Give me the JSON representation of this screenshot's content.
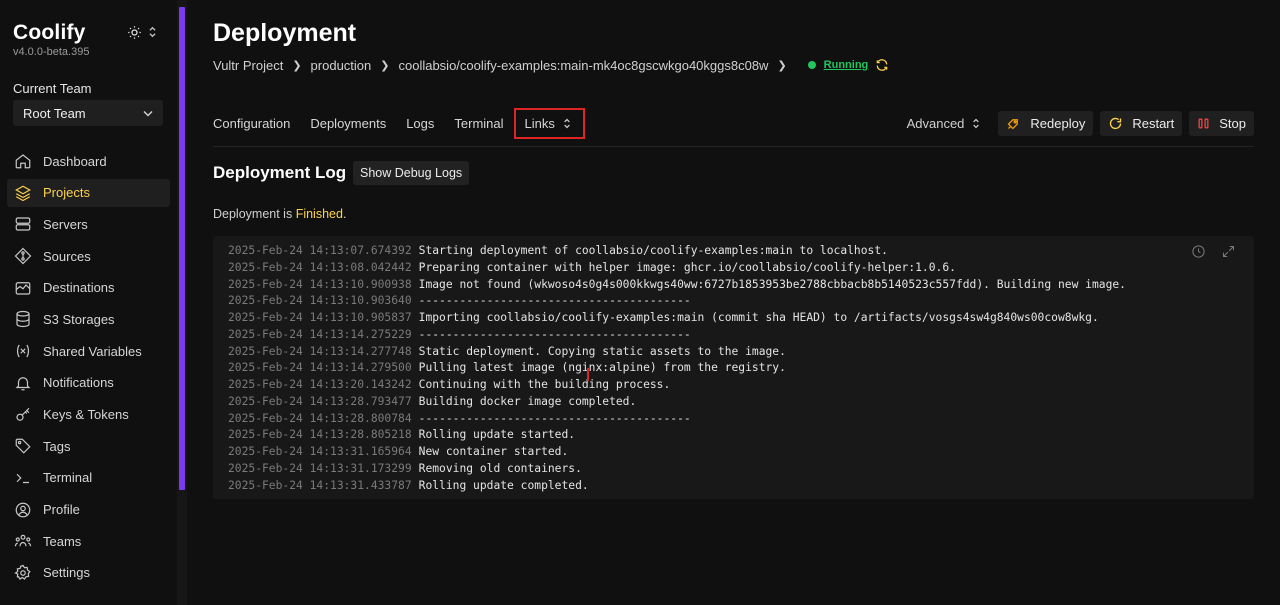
{
  "app": {
    "name": "Coolify",
    "version": "v4.0.0-beta.395"
  },
  "team": {
    "label": "Current Team",
    "selected": "Root Team"
  },
  "sidebar": {
    "items": [
      {
        "label": "Dashboard",
        "icon": "home-icon",
        "active": false
      },
      {
        "label": "Projects",
        "icon": "layers-icon",
        "active": true
      },
      {
        "label": "Servers",
        "icon": "server-icon",
        "active": false
      },
      {
        "label": "Sources",
        "icon": "git-icon",
        "active": false
      },
      {
        "label": "Destinations",
        "icon": "destination-icon",
        "active": false
      },
      {
        "label": "S3 Storages",
        "icon": "database-icon",
        "active": false
      },
      {
        "label": "Shared Variables",
        "icon": "variable-icon",
        "active": false
      },
      {
        "label": "Notifications",
        "icon": "bell-icon",
        "active": false
      },
      {
        "label": "Keys & Tokens",
        "icon": "key-icon",
        "active": false
      },
      {
        "label": "Tags",
        "icon": "tag-icon",
        "active": false
      },
      {
        "label": "Terminal",
        "icon": "terminal-icon",
        "active": false
      },
      {
        "label": "Profile",
        "icon": "user-icon",
        "active": false
      },
      {
        "label": "Teams",
        "icon": "users-icon",
        "active": false
      },
      {
        "label": "Settings",
        "icon": "gear-icon",
        "active": false
      }
    ]
  },
  "header": {
    "title": "Deployment",
    "breadcrumb": [
      "Vultr Project",
      "production",
      "coollabsio/coolify-examples:main-mk4oc8gscwkgo40kggs8c08w"
    ],
    "status": "Running"
  },
  "tabs": {
    "configuration": "Configuration",
    "deployments": "Deployments",
    "logs": "Logs",
    "terminal": "Terminal",
    "links": "Links"
  },
  "actions": {
    "advanced": "Advanced",
    "redeploy": "Redeploy",
    "restart": "Restart",
    "stop": "Stop"
  },
  "log": {
    "title": "Deployment Log",
    "debug_button": "Show Debug Logs",
    "status_prefix": "Deployment is ",
    "status_value": "Finished",
    "status_suffix": ".",
    "lines": [
      {
        "ts": "2025-Feb-24 14:13:07.674392",
        "msg": "Starting deployment of coollabsio/coolify-examples:main to localhost."
      },
      {
        "ts": "2025-Feb-24 14:13:08.042442",
        "msg": "Preparing container with helper image: ghcr.io/coollabsio/coolify-helper:1.0.6."
      },
      {
        "ts": "2025-Feb-24 14:13:10.900938",
        "msg": "Image not found (wkwoso4s0g4s000kkwgs40ww:6727b1853953be2788cbbacb8b5140523c557fdd). Building new image."
      },
      {
        "ts": "2025-Feb-24 14:13:10.903640",
        "msg": "----------------------------------------"
      },
      {
        "ts": "2025-Feb-24 14:13:10.905837",
        "msg": "Importing coollabsio/coolify-examples:main (commit sha HEAD) to /artifacts/vosgs4sw4g840ws00cow8wkg."
      },
      {
        "ts": "2025-Feb-24 14:13:14.275229",
        "msg": "----------------------------------------"
      },
      {
        "ts": "2025-Feb-24 14:13:14.277748",
        "msg": "Static deployment. Copying static assets to the image."
      },
      {
        "ts": "2025-Feb-24 14:13:14.279500",
        "msg": "Pulling latest image (nginx:alpine) from the registry."
      },
      {
        "ts": "2025-Feb-24 14:13:20.143242",
        "msg": "Continuing with the building process."
      },
      {
        "ts": "2025-Feb-24 14:13:28.793477",
        "msg": "Building docker image completed."
      },
      {
        "ts": "2025-Feb-24 14:13:28.800784",
        "msg": "----------------------------------------"
      },
      {
        "ts": "2025-Feb-24 14:13:28.805218",
        "msg": "Rolling update started."
      },
      {
        "ts": "2025-Feb-24 14:13:31.165964",
        "msg": "New container started."
      },
      {
        "ts": "2025-Feb-24 14:13:31.173299",
        "msg": "Removing old containers."
      },
      {
        "ts": "2025-Feb-24 14:13:31.433787",
        "msg": "Rolling update completed."
      }
    ]
  },
  "colors": {
    "accent": "#fcd34d",
    "running": "#22c55e",
    "highlight": "#dc2626",
    "scrollbar": "#7c3aed"
  }
}
